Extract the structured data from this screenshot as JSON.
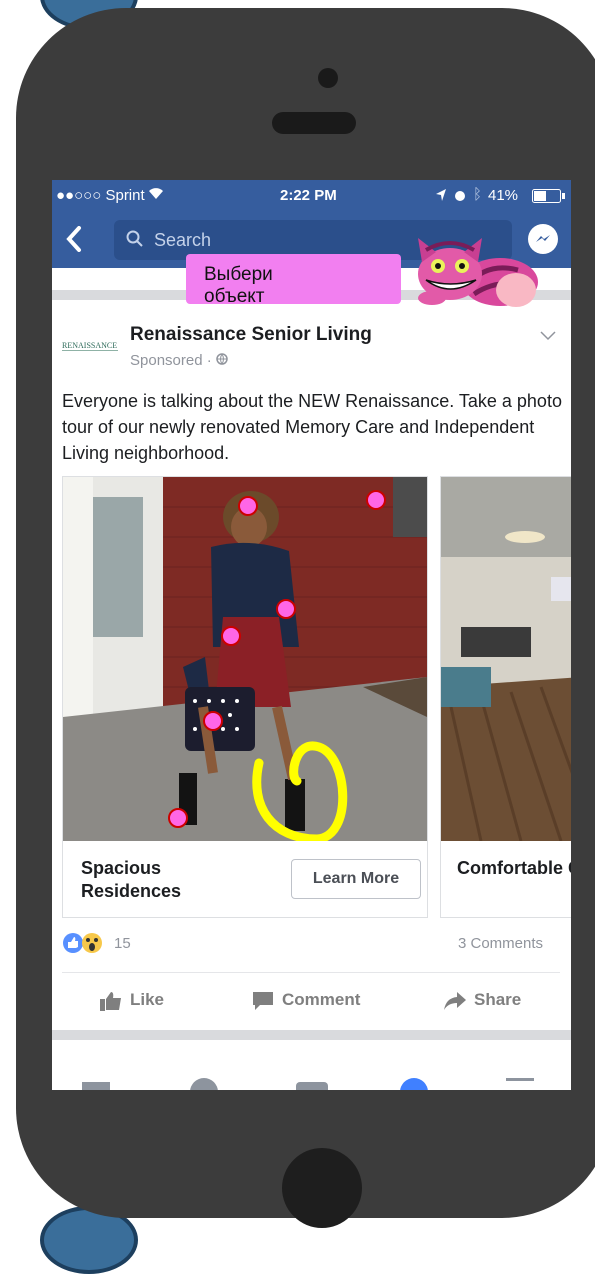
{
  "status_bar": {
    "carrier": "●●○○○ Sprint",
    "time": "2:22 PM",
    "battery": "41%"
  },
  "nav": {
    "search_placeholder": "Search"
  },
  "tooltip": {
    "text": "Выбери объект"
  },
  "post": {
    "page_name": "Renaissance Senior Living",
    "sponsored": "Sponsored · ",
    "logo_text": "RENAISSANCE",
    "body": "Everyone is talking about the NEW Renaissance. Take a photo tour of our newly renovated Memory Care and Independent Living neighborhood.",
    "cards": [
      {
        "title": "Spacious Residences",
        "button": "Learn More"
      },
      {
        "title": "Comfortable Community"
      }
    ],
    "reaction_count": "15",
    "comments": "3 Comments",
    "actions": {
      "like": "Like",
      "comment": "Comment",
      "share": "Share"
    }
  },
  "colors": {
    "facebook_blue": "#365d9e",
    "tooltip_pink": "#f27ff0",
    "marker_pink": "#ff66e6",
    "highlight_yellow": "#ffff00"
  },
  "icons": [
    "back-icon",
    "search-icon",
    "messenger-icon",
    "chevron-down-icon",
    "globe-icon",
    "like-icon",
    "comment-icon",
    "share-icon",
    "news-feed-icon",
    "video-icon",
    "marketplace-icon",
    "notifications-icon",
    "menu-icon"
  ]
}
